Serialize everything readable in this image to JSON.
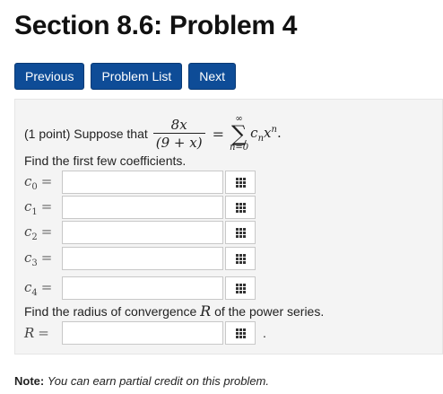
{
  "page": {
    "title": "Section 8.6: Problem 4"
  },
  "nav": {
    "previous": "Previous",
    "problem_list": "Problem List",
    "next": "Next"
  },
  "problem": {
    "points": "(1 point)",
    "suppose": "Suppose that",
    "frac_num": "8x",
    "frac_den": "(9 + x)",
    "equals": "=",
    "sum_upper": "∞",
    "sum_lower": "n=0",
    "term_c": "c",
    "term_n": "n",
    "term_x": "x",
    "term_end": ".",
    "find_coeffs": "Find the first few coefficients.",
    "coefficients": [
      {
        "var": "c",
        "sub": "0",
        "eq": "=",
        "value": ""
      },
      {
        "var": "c",
        "sub": "1",
        "eq": "=",
        "value": ""
      },
      {
        "var": "c",
        "sub": "2",
        "eq": "=",
        "value": ""
      },
      {
        "var": "c",
        "sub": "3",
        "eq": "=",
        "value": ""
      },
      {
        "var": "c",
        "sub": "4",
        "eq": "=",
        "value": ""
      }
    ],
    "find_radius_a": "Find the radius of convergence",
    "radius_var": "R",
    "find_radius_b": "of the power series.",
    "radius_label": "R",
    "radius_eq": "=",
    "radius_value": "",
    "radius_period": "."
  },
  "note": {
    "label": "Note:",
    "text": "You can earn partial credit on this problem."
  },
  "icons": {
    "keyboard": "grid-keyboard-icon"
  },
  "colors": {
    "button_bg": "#0e4c97",
    "panel_bg": "#f4f4f4"
  }
}
